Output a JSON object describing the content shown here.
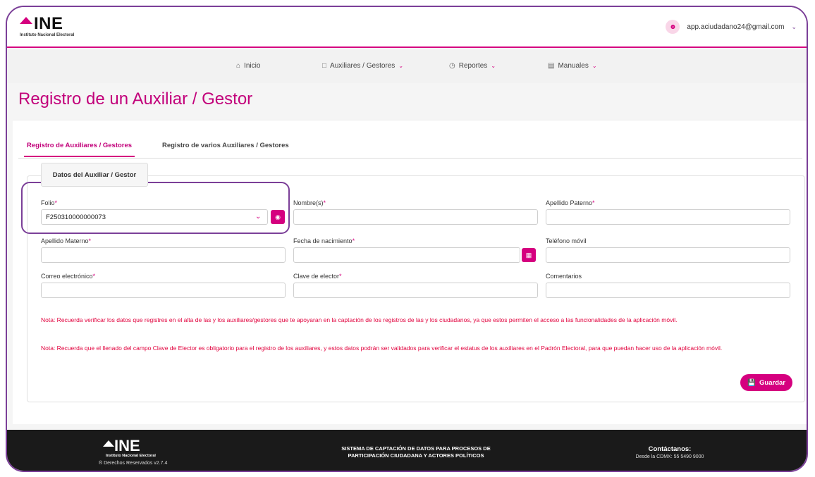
{
  "header": {
    "logo_text": "INE",
    "logo_subtitle": "Instituto Nacional Electoral",
    "user_email": "app.aciudadano24@gmail.com"
  },
  "nav": {
    "items": [
      {
        "label": "Inicio",
        "icon": "home-icon"
      },
      {
        "label": "Auxiliares / Gestores",
        "icon": "document-icon",
        "dropdown": true
      },
      {
        "label": "Reportes",
        "icon": "clock-icon",
        "dropdown": true
      },
      {
        "label": "Manuales",
        "icon": "file-icon",
        "dropdown": true
      }
    ]
  },
  "page": {
    "title": "Registro de un Auxiliar / Gestor",
    "tabs": [
      "Registro de Auxiliares / Gestores",
      "Registro de varios Auxiliares / Gestores"
    ],
    "section_title": "Datos del Auxiliar / Gestor"
  },
  "form": {
    "folio": {
      "label": "Folio",
      "value": "F250310000000073"
    },
    "nombre": {
      "label": "Nombre(s)",
      "value": ""
    },
    "apellido_paterno": {
      "label": "Apellido Paterno",
      "value": ""
    },
    "apellido_materno": {
      "label": "Apellido Materno",
      "value": ""
    },
    "fecha_nacimiento": {
      "label": "Fecha de nacimiento",
      "value": ""
    },
    "telefono": {
      "label": "Teléfono móvil",
      "value": ""
    },
    "correo": {
      "label": "Correo electrónico",
      "value": ""
    },
    "clave_elector": {
      "label": "Clave de elector",
      "value": ""
    },
    "comentarios": {
      "label": "Comentarios",
      "value": ""
    }
  },
  "notes": [
    "Nota: Recuerda verificar los datos que registres en el alta de las y los auxiliares/gestores que te apoyaran en la captación de los registros de las y los ciudadanos, ya que estos permiten el acceso a las funcionalidades de la aplicación móvil.",
    "Nota: Recuerda que el llenado del campo Clave de Elector es obligatorio para el registro de los auxiliares, y estos datos podrán ser validados para verificar el estatus de los auxiliares en el Padrón Electoral, para que puedan hacer uso de la aplicación móvil."
  ],
  "save_label": "Guardar",
  "footer": {
    "logo_text": "INE",
    "logo_subtitle": "Instituto Nacional Electoral",
    "rights": "® Derechos Reservados v2.7.4",
    "center_line1": "SISTEMA DE CAPTACIÓN DE DATOS PARA PROCESOS DE",
    "center_line2": "PARTICIPACIÓN CIUDADANA Y ACTORES POLÍTICOS",
    "contact_title": "Contáctanos:",
    "contact_phone": "Desde la CDMX: 55 5490 9000"
  },
  "colors": {
    "brand": "#d5007f",
    "accent": "#7b3f98"
  }
}
